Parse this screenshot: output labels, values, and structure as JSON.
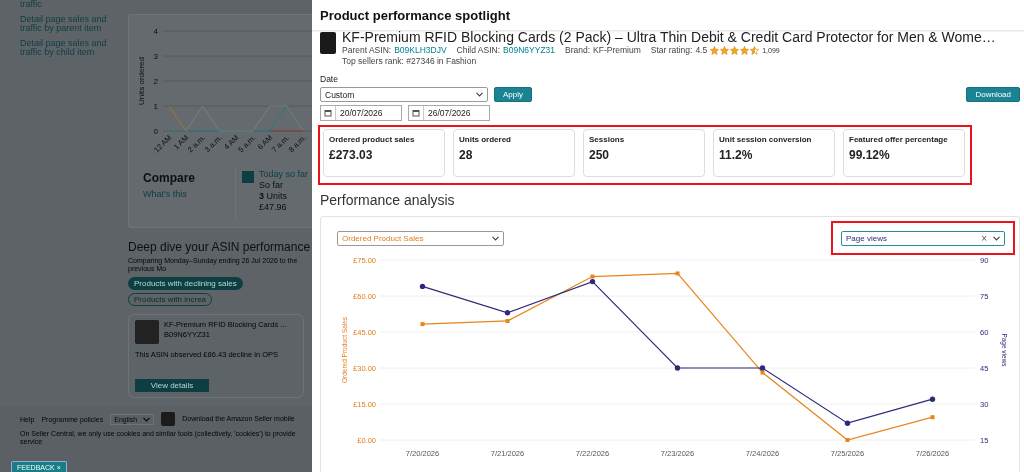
{
  "background_page": {
    "nav_links": [
      "traffic",
      "Detail page sales and traffic by parent item",
      "Detail page sales and traffic by child item"
    ],
    "units_chart": {
      "chart_data": {
        "type": "line",
        "grid": true,
        "ylabel": "Units ordered",
        "categories": [
          "12 AM",
          "1 AM",
          "2 a.m.",
          "3 a.m.",
          "4 AM",
          "5 a.m.",
          "6 AM",
          "7 a.m.",
          "8 a.m."
        ],
        "ylim": [
          0,
          4
        ],
        "yticks": [
          0,
          1,
          2,
          3,
          4
        ],
        "series": [
          {
            "color": "#2b7b80",
            "values": [
              0,
              0,
              0,
              0,
              0,
              0,
              0,
              1,
              0
            ]
          },
          {
            "color": "#7a7e82",
            "values": [
              null,
              0,
              1,
              0,
              0,
              0,
              1,
              1,
              0
            ]
          },
          {
            "color": "#a8742c",
            "values": [
              1,
              0,
              null,
              null,
              null,
              null,
              null,
              null,
              null
            ]
          },
          {
            "color": "#8a3a30",
            "values": [
              null,
              null,
              null,
              null,
              null,
              null,
              0,
              0,
              0
            ]
          }
        ]
      }
    },
    "compare": {
      "title": "Compare",
      "link": "What's this",
      "today": {
        "checked": true,
        "label": "Today so far",
        "lines": [
          "So far",
          "**3** Units",
          "£47.96"
        ]
      }
    },
    "deep_dive": {
      "title": "Deep dive your ASIN performance",
      "subtitle": "Comparing Monday–Sunday ending 26 Jul 2026 to the previous Mo",
      "filters": [
        {
          "label": "Products with declining sales",
          "selected": true
        },
        {
          "label": "Products with increa",
          "selected": false
        }
      ],
      "card": {
        "title": "KF-Premium RFID Blocking Cards ...",
        "asin": "B09N6YYZ31",
        "note": "This ASIN observed £86.43 decline in OPS",
        "button": "View details"
      }
    },
    "footer": {
      "links": [
        "Help",
        "Programme policies"
      ],
      "language": "English",
      "app_text": "Download the Amazon Seller mobile",
      "cookie_text": "On Seller Central, we only use cookies and similar tools (collectively, 'cookies') to provide service"
    },
    "feedback": {
      "label": "FEEDBACK",
      "close": "×"
    }
  },
  "panel": {
    "title": "Product performance spotlight",
    "product": {
      "title": "KF-Premium RFID Blocking Cards (2 Pack) – Ultra Thin Debit & Credit Card Protector for Men & Wome…",
      "details": [
        {
          "kind": "link",
          "label": "Parent ASIN:",
          "value": "B09KLH3DJV"
        },
        {
          "kind": "link",
          "label": "Child ASIN:",
          "value": "B09N6YYZ31"
        },
        {
          "kind": "text",
          "label": "Brand:",
          "value": "KF-Premium"
        },
        {
          "kind": "rating",
          "label": "Star rating:",
          "value": "4.5",
          "stars": 4.5,
          "count": "1,099"
        }
      ],
      "rank": "Top sellers rank: #27346 in Fashion"
    },
    "date_filter": {
      "label": "Date",
      "range": "Custom",
      "apply": "Apply",
      "download": "Download",
      "start": "20/07/2026",
      "end": "26/07/2026"
    },
    "metrics": {
      "highlighted": true,
      "items": [
        {
          "label": "Ordered product sales",
          "value": "£273.03"
        },
        {
          "label": "Units ordered",
          "value": "28"
        },
        {
          "label": "Sessions",
          "value": "250"
        },
        {
          "label": "Unit session conversion",
          "value": "11.2%"
        },
        {
          "label": "Featured offer percentage",
          "value": "99.12%"
        }
      ]
    },
    "analysis": {
      "title": "Performance analysis",
      "secondary_select": {
        "clear": "×",
        "highlighted": true
      },
      "chart_data": {
        "type": "line",
        "grid": true,
        "ylabel": "Ordered Product Sales",
        "y2label": "Page views",
        "categories": [
          "7/20/2026",
          "7/21/2026",
          "7/22/2026",
          "7/23/2026",
          "7/24/2026",
          "7/25/2026",
          "7/26/2026"
        ],
        "ylim": [
          0,
          75
        ],
        "y2lim": [
          15,
          90
        ],
        "yticks": [
          {
            "value": 0,
            "label": "£0.00"
          },
          {
            "value": 15,
            "label": "£15.00"
          },
          {
            "value": 30,
            "label": "£30.00"
          },
          {
            "value": 45,
            "label": "£45.00"
          },
          {
            "value": 60,
            "label": "£60.00"
          },
          {
            "value": 75,
            "label": "£75.00"
          }
        ],
        "y2ticks": [
          15,
          30,
          45,
          60,
          75,
          90
        ],
        "series": [
          {
            "name": "Ordered Product Sales",
            "color": "#e8851a",
            "marker": "square",
            "values": [
              48.3,
              49.6,
              68.1,
              69.4,
              28.1,
              0,
              9.5
            ]
          },
          {
            "name": "Page views",
            "color": "#2e2a7a",
            "axis": "y2",
            "values": [
              79,
              68,
              81,
              45,
              45,
              22,
              32
            ]
          }
        ]
      }
    }
  }
}
